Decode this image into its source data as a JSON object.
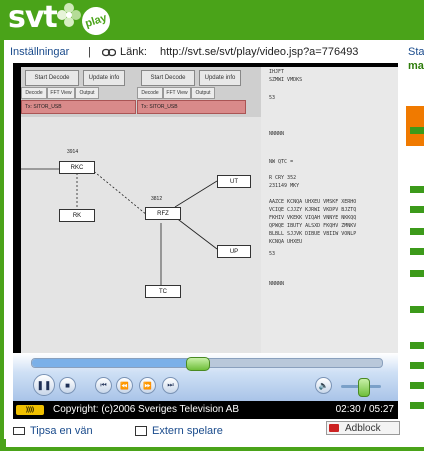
{
  "header": {
    "logo_text": "svt",
    "badge_text": "play",
    "brand_color": "#4aa319"
  },
  "toolbar": {
    "settings_label": "Inställningar",
    "separator": "|",
    "link_icon": "link-icon",
    "link_label": "Länk:",
    "link_url": "http://svt.se/svt/play/video.jsp?a=776493"
  },
  "right_panel": {
    "title_fragment": "Sta",
    "subtitle_fragment": "ma"
  },
  "video": {
    "sheet": {
      "buttons": [
        "Start Decode",
        "Update info",
        "Start Decode",
        "Update info"
      ],
      "tabs": [
        "Decode",
        "FFT View",
        "Output",
        "Decode",
        "FFT View",
        "Output"
      ],
      "red_bars": [
        "Tx: SITOR_USB",
        "Tx: SITOR_USB"
      ],
      "nodes": [
        "RKC",
        "RK",
        "RFZ",
        "UT",
        "UP",
        "TC"
      ],
      "node_numbers": [
        "3914",
        "3812"
      ]
    },
    "terminal_lines": [
      "IHJFT",
      "SZMWI VMDKS",
      "53",
      "NNNNN",
      "NW QTC =",
      "R CRY 352",
      "231149 MKY",
      "AAZCE KCNQA UHXEU VMSKF XERHO",
      "VCIQE CJJZY KJRWI VKDPV BJZTQ",
      "FKHIV VKEKK VIQAH VNNYE NKKQQ",
      "QPWQE IBUTY ALSXD FKQHV ZMNKV",
      "BLBLL SJJVK DIBUE VBIIW VONLP",
      "KCNQA UHXEU",
      "53",
      "NNNNN"
    ]
  },
  "player": {
    "seek_progress": 0.47,
    "volume_level": 0.55,
    "copyright": "Copyright: (c)2006 Sveriges Television AB",
    "time": "02:30 / 05:27",
    "status_logo": "))))"
  },
  "bottom": {
    "tell_friend": "Tipsa en vän",
    "external_player": "Extern spelare",
    "adblock": "Adblock"
  },
  "icons": {
    "play_pause": "pause-icon",
    "stop": "stop-icon",
    "prev": "previous-icon",
    "rewind": "rewind-icon",
    "forward": "fast-forward-icon",
    "next": "next-icon",
    "mute": "speaker-icon"
  }
}
